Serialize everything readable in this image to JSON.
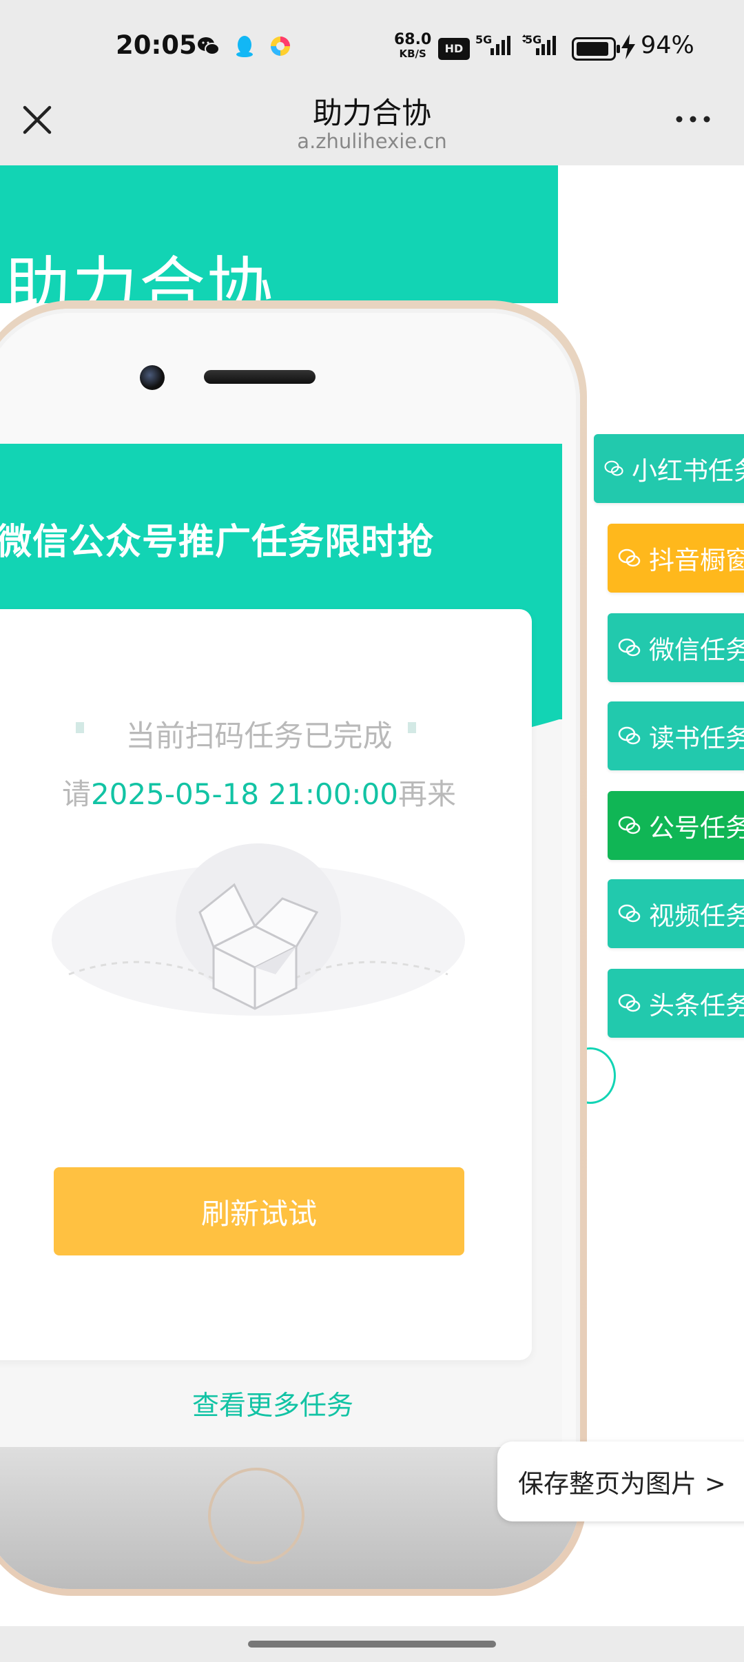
{
  "status_bar": {
    "time": "20:05",
    "net_speed_value": "68.0",
    "net_speed_unit": "KB/S",
    "hd_badge": "HD",
    "signal1": "5G",
    "signal2": "5G",
    "battery_pct": "94%",
    "icons": [
      "wechat-icon",
      "qq-icon",
      "colorful-app-icon"
    ]
  },
  "title_bar": {
    "title": "助力合协",
    "url": "a.zhulihexie.cn"
  },
  "hero": {
    "title": "助力合协"
  },
  "side_tabs": [
    {
      "label": "小红书任务",
      "color": "#22c9ad"
    },
    {
      "label": "抖音橱窗",
      "color": "#ffb81c"
    },
    {
      "label": "微信任务",
      "color": "#22c9ad"
    },
    {
      "label": "读书任务",
      "color": "#22c9ad"
    },
    {
      "label": "公号任务",
      "color": "#10b655"
    },
    {
      "label": "视频任务",
      "color": "#22c9ad"
    },
    {
      "label": "头条任务",
      "color": "#22c9ad"
    }
  ],
  "inner_screen": {
    "title": "微信公众号推广任务限时抢",
    "message_line1": "当前扫码任务已完成",
    "message_prefix": "请",
    "message_time": "2025-05-18 21:00:00",
    "message_suffix": "再来",
    "refresh_button": "刷新试试",
    "more_tasks_link": "查看更多任务"
  },
  "save_button": "保存整页为图片 >",
  "colors": {
    "accent": "#12d4b4",
    "button": "#ffc141"
  }
}
